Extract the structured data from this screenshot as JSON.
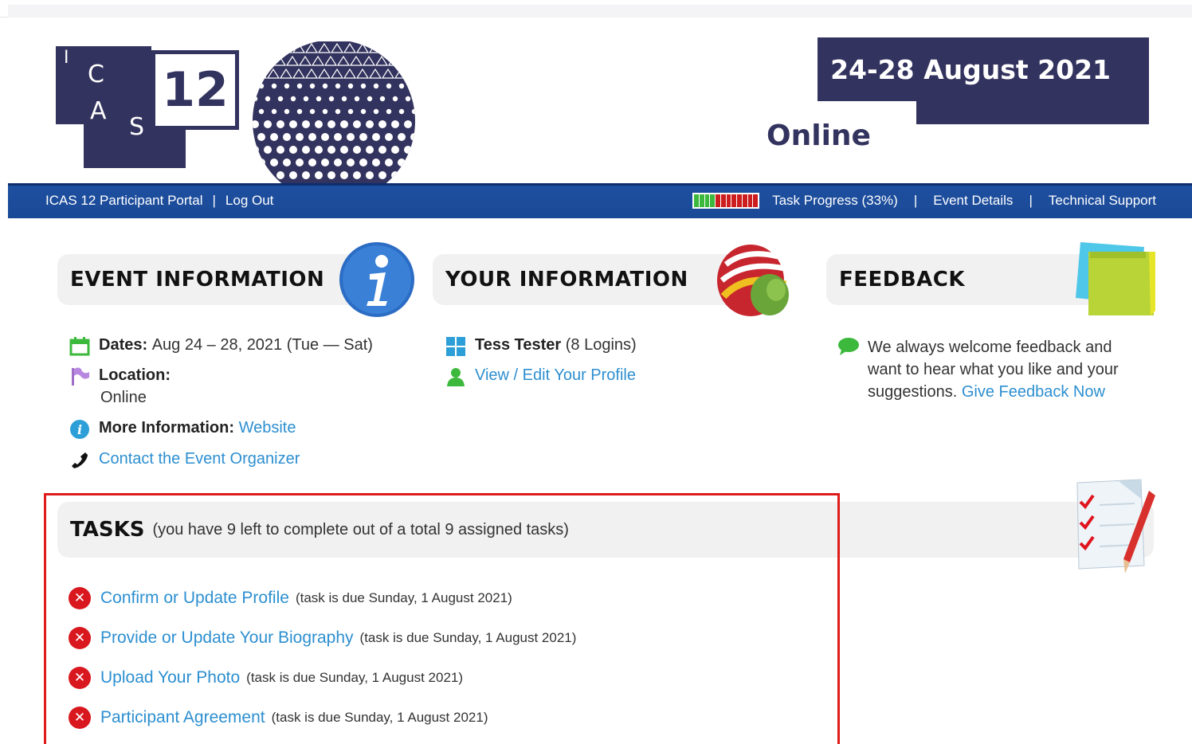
{
  "header": {
    "logo_letters": [
      "I",
      "C",
      "A",
      "S"
    ],
    "logo_number": "12",
    "dates": "24-28 August 2021",
    "location_word": "Online"
  },
  "nav": {
    "portal": "ICAS 12 Participant Portal",
    "logout": "Log Out",
    "sep": "|",
    "task_progress": "Task Progress (33%)",
    "progress_fraction": 0.33,
    "event_details": "Event Details",
    "technical_support": "Technical Support",
    "colors": {
      "bar": "#1e4fa0",
      "progress_done": "#3cb93c",
      "progress_todo": "#cc1e1e"
    }
  },
  "event_info": {
    "title": "EVENT INFORMATION",
    "dates_label": "Dates:",
    "dates_value": "Aug 24 – 28, 2021 (Tue — Sat)",
    "location_label": "Location:",
    "location_value": "Online",
    "more_label": "More Information:",
    "more_link": "Website",
    "contact_link": "Contact the Event Organizer"
  },
  "your_info": {
    "title": "YOUR INFORMATION",
    "name": "Tess Tester",
    "logins": "(8 Logins)",
    "profile_link": "View / Edit Your Profile"
  },
  "feedback": {
    "title": "FEEDBACK",
    "text": "We always welcome feedback and want to hear what you like and your suggestions.",
    "link": "Give Feedback Now"
  },
  "tasks": {
    "title": "TASKS",
    "summary": "(you have 9 left to complete out of a total 9 assigned tasks)",
    "items": [
      {
        "label": "Confirm or Update Profile",
        "due": "(task is due Sunday, 1 August 2021)"
      },
      {
        "label": "Provide or Update Your Biography",
        "due": "(task is due Sunday, 1 August 2021)"
      },
      {
        "label": "Upload Your Photo",
        "due": "(task is due Sunday, 1 August 2021)"
      },
      {
        "label": "Participant Agreement",
        "due": "(task is due Sunday, 1 August 2021)"
      }
    ]
  }
}
